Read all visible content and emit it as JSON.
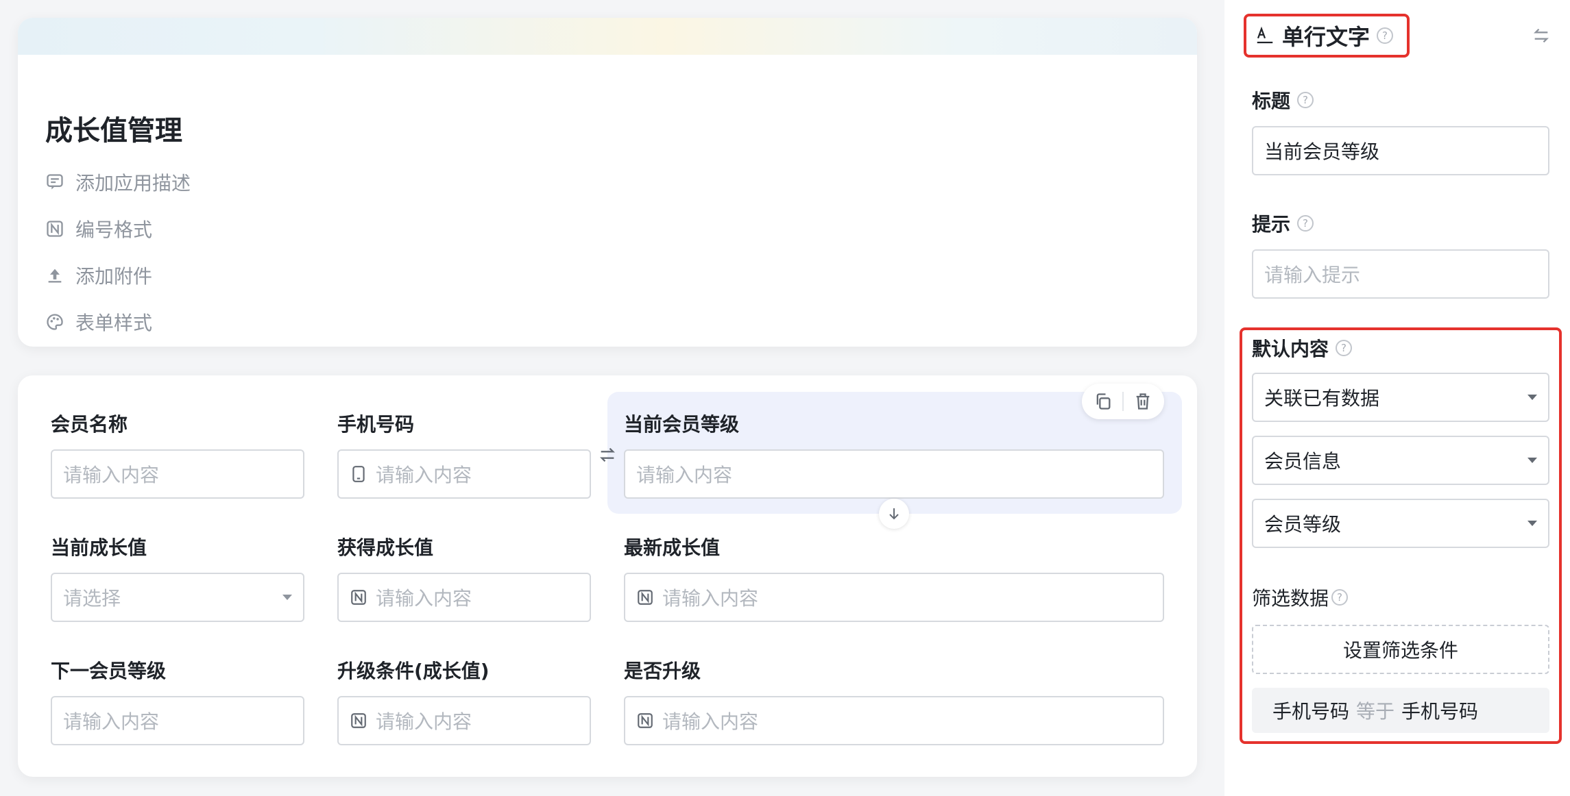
{
  "app": {
    "title": "成长值管理",
    "meta_items": [
      {
        "label": "添加应用描述",
        "icon": "comment-icon"
      },
      {
        "label": "编号格式",
        "icon": "numbering-icon"
      },
      {
        "label": "添加附件",
        "icon": "upload-icon"
      },
      {
        "label": "表单样式",
        "icon": "palette-icon"
      }
    ]
  },
  "form": {
    "fields": [
      {
        "label": "会员名称",
        "placeholder": "请输入内容",
        "type": "text",
        "icon": null
      },
      {
        "label": "手机号码",
        "placeholder": "请输入内容",
        "type": "phone",
        "icon": "phone-icon"
      },
      {
        "label": "当前会员等级",
        "placeholder": "请输入内容",
        "type": "text",
        "icon": null,
        "selected": true
      },
      {
        "label": "当前成长值",
        "placeholder": "请选择",
        "type": "select",
        "icon": "chevron-down-icon"
      },
      {
        "label": "获得成长值",
        "placeholder": "请输入内容",
        "type": "number",
        "icon": "number-icon"
      },
      {
        "label": "最新成长值",
        "placeholder": "请输入内容",
        "type": "number",
        "icon": "number-icon"
      },
      {
        "label": "下一会员等级",
        "placeholder": "请输入内容",
        "type": "text",
        "icon": null
      },
      {
        "label": "升级条件(成长值)",
        "placeholder": "请输入内容",
        "type": "number",
        "icon": "number-icon"
      },
      {
        "label": "是否升级",
        "placeholder": "请输入内容",
        "type": "number",
        "icon": "number-icon"
      }
    ],
    "toolbar_icons": [
      "copy-icon",
      "trash-icon"
    ]
  },
  "panel": {
    "component_type": "单行文字",
    "help_symbol": "?",
    "title_label": "标题",
    "title_value": "当前会员等级",
    "hint_label": "提示",
    "hint_placeholder": "请输入提示",
    "default_label": "默认内容",
    "default_mode": "关联已有数据",
    "source_form": "会员信息",
    "source_field": "会员等级",
    "filter_label": "筛选数据",
    "filter_button": "设置筛选条件",
    "condition": {
      "left": "手机号码",
      "op": "等于",
      "right": "手机号码"
    },
    "colors": {
      "highlight_border": "#e5322d",
      "selected_bg": "#eef1fc"
    }
  }
}
